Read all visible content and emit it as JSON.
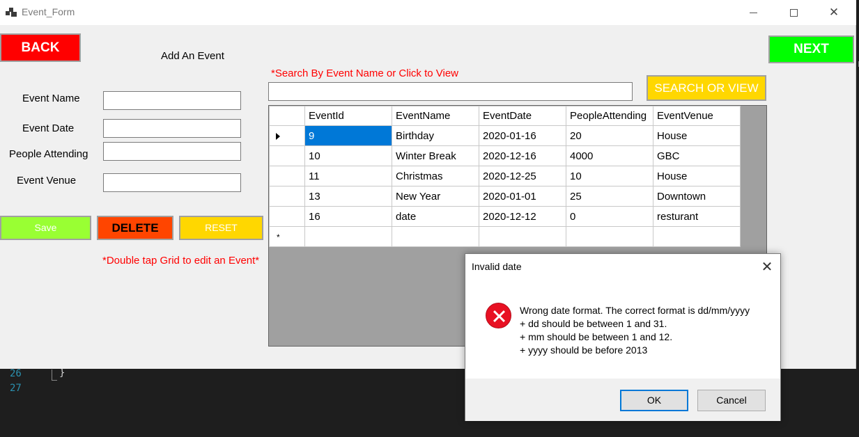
{
  "window": {
    "title": "Event_Form"
  },
  "form": {
    "back_label": "BACK",
    "next_label": "NEXT",
    "heading": "Add An Event",
    "fields": [
      {
        "label": "Event Name",
        "value": ""
      },
      {
        "label": "Event Date",
        "value": ""
      },
      {
        "label": "People Attending",
        "value": ""
      },
      {
        "label": "Event Venue",
        "value": ""
      }
    ],
    "save_label": "Save",
    "delete_label": "DELETE",
    "reset_label": "RESET",
    "edit_hint": "*Double tap Grid to edit an Event*",
    "search_hint": "*Search By Event Name or Click to View",
    "search_value": "",
    "search_label": "SEARCH OR VIEW"
  },
  "grid": {
    "columns": [
      "EventId",
      "EventName",
      "EventDate",
      "PeopleAttending",
      "EventVenue"
    ],
    "rows": [
      [
        "9",
        "Birthday",
        "2020-01-16",
        "20",
        "House"
      ],
      [
        "10",
        "Winter Break",
        "2020-12-16",
        "4000",
        "GBC"
      ],
      [
        "11",
        "Christmas",
        "2020-12-25",
        "10",
        "House"
      ],
      [
        "13",
        "New Year",
        "2020-01-01",
        "25",
        "Downtown"
      ],
      [
        "16",
        "date",
        "2020-12-12",
        "0",
        "resturant"
      ]
    ],
    "new_row_marker": "*"
  },
  "dialog": {
    "title": "Invalid date",
    "close_glyph": "✕",
    "message_lines": [
      "Wrong date format. The correct format is dd/mm/yyyy",
      "+ dd should be between 1 and 31.",
      "+ mm should be between 1 and 12.",
      "+ yyyy should be before 2013"
    ],
    "ok_label": "OK",
    "cancel_label": "Cancel"
  },
  "editor": {
    "lines": [
      {
        "number": "26",
        "code": "}"
      },
      {
        "number": "27",
        "code": ""
      }
    ]
  },
  "colors": {
    "back": "#ff0000",
    "next": "#00ff00",
    "save": "#99ff33",
    "delete": "#ff4500",
    "reset": "#ffd700",
    "selection": "#0078d7",
    "error": "#e81123"
  },
  "icons": [
    "app-window-icon",
    "minimize-icon",
    "maximize-icon",
    "close-icon",
    "error-icon",
    "row-pointer-icon"
  ]
}
